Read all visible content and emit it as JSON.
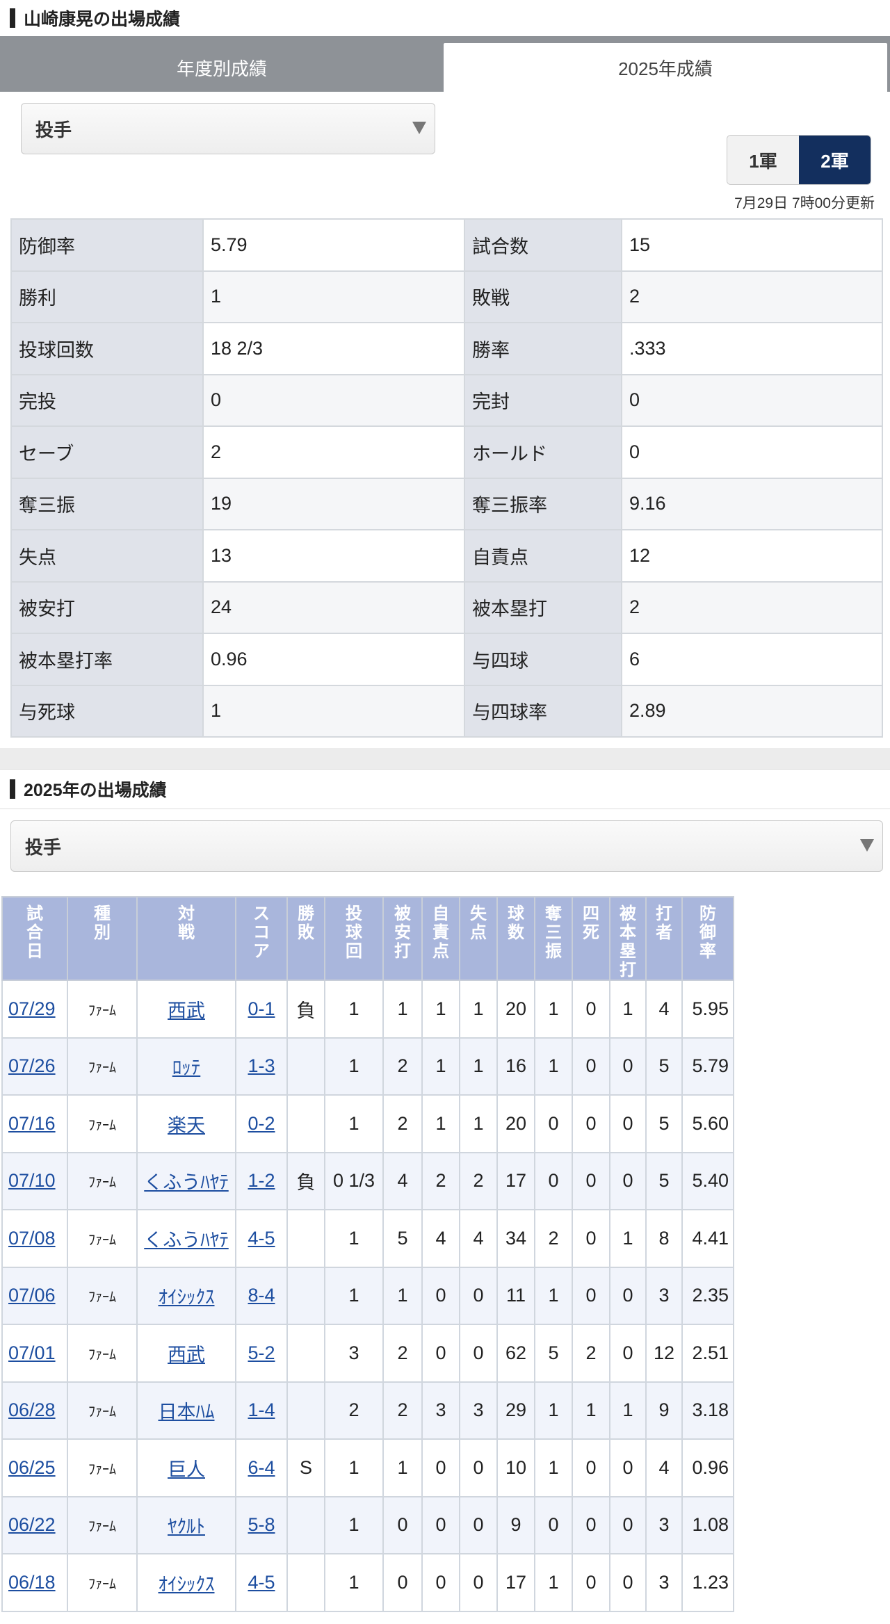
{
  "header": {
    "title": "山崎康晃の出場成績"
  },
  "tabs": [
    {
      "label": "年度別成績",
      "active": false
    },
    {
      "label": "2025年成績",
      "active": true
    }
  ],
  "filter1": {
    "value": "投手"
  },
  "toggle": {
    "first": "1軍",
    "second": "2軍",
    "selected": "2軍"
  },
  "updated": "7月29日 7時00分更新",
  "stats": [
    [
      "防御率",
      "5.79",
      "試合数",
      "15"
    ],
    [
      "勝利",
      "1",
      "敗戦",
      "2"
    ],
    [
      "投球回数",
      "18 2/3",
      "勝率",
      ".333"
    ],
    [
      "完投",
      "0",
      "完封",
      "0"
    ],
    [
      "セーブ",
      "2",
      "ホールド",
      "0"
    ],
    [
      "奪三振",
      "19",
      "奪三振率",
      "9.16"
    ],
    [
      "失点",
      "13",
      "自責点",
      "12"
    ],
    [
      "被安打",
      "24",
      "被本塁打",
      "2"
    ],
    [
      "被本塁打率",
      "0.96",
      "与四球",
      "6"
    ],
    [
      "与死球",
      "1",
      "与四球率",
      "2.89"
    ]
  ],
  "section2": {
    "title": "2025年の出場成績"
  },
  "filter2": {
    "value": "投手"
  },
  "games_headers": [
    "試合日",
    "種別",
    "対戦",
    "スコア",
    "勝敗",
    "投球回",
    "被安打",
    "自責点",
    "失点",
    "球数",
    "奪三振",
    "四死",
    "被本塁打",
    "打者",
    "防御率"
  ],
  "games": [
    [
      "07/29",
      "ﾌｧｰﾑ",
      "西武",
      "0-1",
      "負",
      "1",
      "1",
      "1",
      "1",
      "20",
      "1",
      "0",
      "1",
      "4",
      "5.95"
    ],
    [
      "07/26",
      "ﾌｧｰﾑ",
      "ﾛｯﾃ",
      "1-3",
      "",
      "1",
      "2",
      "1",
      "1",
      "16",
      "1",
      "0",
      "0",
      "5",
      "5.79"
    ],
    [
      "07/16",
      "ﾌｧｰﾑ",
      "楽天",
      "0-2",
      "",
      "1",
      "2",
      "1",
      "1",
      "20",
      "0",
      "0",
      "0",
      "5",
      "5.60"
    ],
    [
      "07/10",
      "ﾌｧｰﾑ",
      "くふうﾊﾔﾃ",
      "1-2",
      "負",
      "0 1/3",
      "4",
      "2",
      "2",
      "17",
      "0",
      "0",
      "0",
      "5",
      "5.40"
    ],
    [
      "07/08",
      "ﾌｧｰﾑ",
      "くふうﾊﾔﾃ",
      "4-5",
      "",
      "1",
      "5",
      "4",
      "4",
      "34",
      "2",
      "0",
      "1",
      "8",
      "4.41"
    ],
    [
      "07/06",
      "ﾌｧｰﾑ",
      "ｵｲｼｯｸｽ",
      "8-4",
      "",
      "1",
      "1",
      "0",
      "0",
      "11",
      "1",
      "0",
      "0",
      "3",
      "2.35"
    ],
    [
      "07/01",
      "ﾌｧｰﾑ",
      "西武",
      "5-2",
      "",
      "3",
      "2",
      "0",
      "0",
      "62",
      "5",
      "2",
      "0",
      "12",
      "2.51"
    ],
    [
      "06/28",
      "ﾌｧｰﾑ",
      "日本ﾊﾑ",
      "1-4",
      "",
      "2",
      "2",
      "3",
      "3",
      "29",
      "1",
      "1",
      "1",
      "9",
      "3.18"
    ],
    [
      "06/25",
      "ﾌｧｰﾑ",
      "巨人",
      "6-4",
      "S",
      "1",
      "1",
      "0",
      "0",
      "10",
      "1",
      "0",
      "0",
      "4",
      "0.96"
    ],
    [
      "06/22",
      "ﾌｧｰﾑ",
      "ﾔｸﾙﾄ",
      "5-8",
      "",
      "1",
      "0",
      "0",
      "0",
      "9",
      "0",
      "0",
      "0",
      "3",
      "1.08"
    ],
    [
      "06/18",
      "ﾌｧｰﾑ",
      "ｵｲｼｯｸｽ",
      "4-5",
      "",
      "1",
      "0",
      "0",
      "0",
      "17",
      "1",
      "0",
      "0",
      "3",
      "1.23"
    ]
  ]
}
